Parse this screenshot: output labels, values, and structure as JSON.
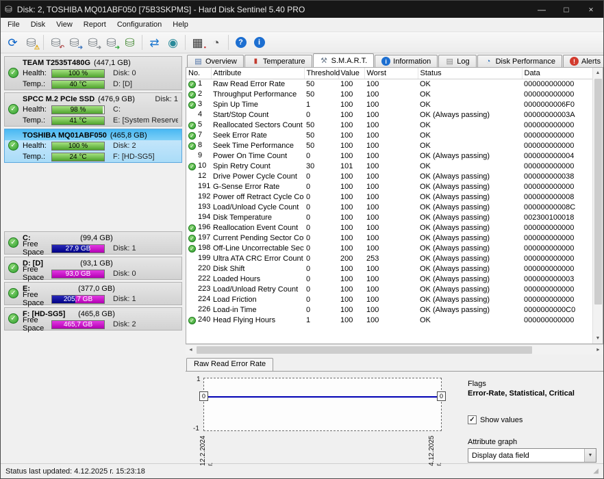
{
  "window": {
    "title": "Disk: 2, TOSHIBA MQ01ABF050 [75B3SKPMS]  -  Hard Disk Sentinel 5.40 PRO",
    "app_icon_glyph": "⛁",
    "minimize_glyph": "—",
    "maximize_glyph": "□",
    "close_glyph": "×"
  },
  "menu": {
    "items": [
      "File",
      "Disk",
      "View",
      "Report",
      "Configuration",
      "Help"
    ]
  },
  "toolbar": {
    "separators_after": [
      1,
      6,
      8,
      10
    ],
    "buttons": [
      {
        "name": "refresh-status",
        "glyph": "⟳",
        "color": "#0c64c8"
      },
      {
        "name": "disk-warning",
        "glyph": "⛁",
        "color": "#7a8187",
        "badge": "⚠",
        "badge_color": "#dd9f00"
      },
      {
        "name": "disk-remove",
        "glyph": "⛁",
        "color": "#7a8187",
        "badge": "↶",
        "badge_color": "#b05050"
      },
      {
        "name": "disk-test-read",
        "glyph": "⛁",
        "color": "#7a8187",
        "badge": "➜",
        "badge_color": "#4a7ec0"
      },
      {
        "name": "disk-test-write",
        "glyph": "⛁",
        "color": "#7a8187",
        "badge": "➜",
        "badge_color": "#8a8f94"
      },
      {
        "name": "disk-test-seek",
        "glyph": "⛁",
        "color": "#7a8187",
        "badge": "➜",
        "badge_color": "#3fae49"
      },
      {
        "name": "disk-backup",
        "glyph": "⛁",
        "color": "#4f8f3f"
      },
      {
        "name": "sync",
        "glyph": "⇄",
        "color": "#1e78d0"
      },
      {
        "name": "network-status",
        "glyph": "◉",
        "color": "#2a8a9a"
      },
      {
        "name": "levels",
        "glyph": "▦",
        "color": "#383838",
        "badge": "▪",
        "badge_color": "#c43232"
      },
      {
        "name": "gauge",
        "glyph": "◔",
        "color": "#565656"
      },
      {
        "name": "help",
        "glyph": "?",
        "color": "#ffffff",
        "circle": "#1d6fd1"
      },
      {
        "name": "info",
        "glyph": "i",
        "color": "#ffffff",
        "circle": "#1d6fd1"
      }
    ]
  },
  "sidebar": {
    "disks": [
      {
        "name": "TEAM T2535T480G",
        "size": "(447,1 GB)",
        "header_right": "",
        "health_label": "Health:",
        "health_value": "100 %",
        "health_pct": 100,
        "health_right": "Disk: 0",
        "temp_label": "Temp.:",
        "temp_value": "40 °C",
        "temp_pct": 100,
        "temp_right": "D: [D]",
        "selected": false
      },
      {
        "name": "SPCC M.2 PCIe SSD",
        "size": "(476,9 GB)",
        "header_right": "Disk: 1",
        "health_label": "Health:",
        "health_value": "98 %",
        "health_pct": 98,
        "health_right": "C:",
        "temp_label": "Temp.:",
        "temp_value": "41 °C",
        "temp_pct": 100,
        "temp_right": "E: [System Reserved]",
        "selected": false
      },
      {
        "name": "TOSHIBA MQ01ABF050",
        "size": "(465,8 GB)",
        "header_right": "",
        "health_label": "Health:",
        "health_value": "100 %",
        "health_pct": 100,
        "health_right": "Disk: 2",
        "temp_label": "Temp.:",
        "temp_value": "24 °C",
        "temp_pct": 100,
        "temp_right": "F: [HD-SG5]",
        "selected": true
      }
    ],
    "partitions": [
      {
        "letter": "C:",
        "size": "(99,4 GB)",
        "free_label": "Free Space",
        "free_value": "27,9 GB",
        "free_pct": 28,
        "right": "Disk: 1"
      },
      {
        "letter": "D: [D]",
        "size": "(93,1 GB)",
        "free_label": "Free Space",
        "free_value": "93,0 GB",
        "free_pct": 100,
        "right": "Disk: 0"
      },
      {
        "letter": "E:",
        "size": "(377,0 GB)",
        "free_label": "Free Space",
        "free_value": "205,7 GB",
        "free_pct": 55,
        "right": "Disk: 1"
      },
      {
        "letter": "F: [HD-SG5]",
        "size": "(465,8 GB)",
        "free_label": "Free Space",
        "free_value": "465,7 GB",
        "free_pct": 100,
        "right": "Disk: 2"
      }
    ]
  },
  "tabs": [
    {
      "label": "Overview",
      "icon": "overview",
      "active": false
    },
    {
      "label": "Temperature",
      "icon": "temperature",
      "active": false
    },
    {
      "label": "S.M.A.R.T.",
      "icon": "smart",
      "active": true
    },
    {
      "label": "Information",
      "icon": "information",
      "active": false
    },
    {
      "label": "Log",
      "icon": "log",
      "active": false
    },
    {
      "label": "Disk Performance",
      "icon": "performance",
      "active": false
    },
    {
      "label": "Alerts",
      "icon": "alerts",
      "active": false
    }
  ],
  "smart": {
    "columns": [
      "No.",
      "Attribute",
      "Threshold",
      "Value",
      "Worst",
      "Status",
      "Data"
    ],
    "rows": [
      {
        "ok": true,
        "no": "1",
        "attribute": "Raw Read Error Rate",
        "threshold": "50",
        "value": "100",
        "worst": "100",
        "status": "OK",
        "data": "000000000000"
      },
      {
        "ok": true,
        "no": "2",
        "attribute": "Throughput Performance",
        "threshold": "50",
        "value": "100",
        "worst": "100",
        "status": "OK",
        "data": "000000000000"
      },
      {
        "ok": true,
        "no": "3",
        "attribute": "Spin Up Time",
        "threshold": "1",
        "value": "100",
        "worst": "100",
        "status": "OK",
        "data": "0000000006F0"
      },
      {
        "ok": false,
        "no": "4",
        "attribute": "Start/Stop Count",
        "threshold": "0",
        "value": "100",
        "worst": "100",
        "status": "OK (Always passing)",
        "data": "00000000003A"
      },
      {
        "ok": true,
        "no": "5",
        "attribute": "Reallocated Sectors Count",
        "threshold": "50",
        "value": "100",
        "worst": "100",
        "status": "OK",
        "data": "000000000000"
      },
      {
        "ok": true,
        "no": "7",
        "attribute": "Seek Error Rate",
        "threshold": "50",
        "value": "100",
        "worst": "100",
        "status": "OK",
        "data": "000000000000"
      },
      {
        "ok": true,
        "no": "8",
        "attribute": "Seek Time Performance",
        "threshold": "50",
        "value": "100",
        "worst": "100",
        "status": "OK",
        "data": "000000000000"
      },
      {
        "ok": false,
        "no": "9",
        "attribute": "Power On Time Count",
        "threshold": "0",
        "value": "100",
        "worst": "100",
        "status": "OK (Always passing)",
        "data": "000000000004"
      },
      {
        "ok": true,
        "no": "10",
        "attribute": "Spin Retry Count",
        "threshold": "30",
        "value": "101",
        "worst": "100",
        "status": "OK",
        "data": "000000000000"
      },
      {
        "ok": false,
        "no": "12",
        "attribute": "Drive Power Cycle Count",
        "threshold": "0",
        "value": "100",
        "worst": "100",
        "status": "OK (Always passing)",
        "data": "000000000038"
      },
      {
        "ok": false,
        "no": "191",
        "attribute": "G-Sense Error Rate",
        "threshold": "0",
        "value": "100",
        "worst": "100",
        "status": "OK (Always passing)",
        "data": "000000000000"
      },
      {
        "ok": false,
        "no": "192",
        "attribute": "Power off Retract Cycle Count",
        "threshold": "0",
        "value": "100",
        "worst": "100",
        "status": "OK (Always passing)",
        "data": "000000000008"
      },
      {
        "ok": false,
        "no": "193",
        "attribute": "Load/Unload Cycle Count",
        "threshold": "0",
        "value": "100",
        "worst": "100",
        "status": "OK (Always passing)",
        "data": "00000000008C"
      },
      {
        "ok": false,
        "no": "194",
        "attribute": "Disk Temperature",
        "threshold": "0",
        "value": "100",
        "worst": "100",
        "status": "OK (Always passing)",
        "data": "002300100018"
      },
      {
        "ok": true,
        "no": "196",
        "attribute": "Reallocation Event Count",
        "threshold": "0",
        "value": "100",
        "worst": "100",
        "status": "OK (Always passing)",
        "data": "000000000000"
      },
      {
        "ok": true,
        "no": "197",
        "attribute": "Current Pending Sector Count",
        "threshold": "0",
        "value": "100",
        "worst": "100",
        "status": "OK (Always passing)",
        "data": "000000000000"
      },
      {
        "ok": true,
        "no": "198",
        "attribute": "Off-Line Uncorrectable Sector Co...",
        "threshold": "0",
        "value": "100",
        "worst": "100",
        "status": "OK (Always passing)",
        "data": "000000000000"
      },
      {
        "ok": false,
        "no": "199",
        "attribute": "Ultra ATA CRC Error Count",
        "threshold": "0",
        "value": "200",
        "worst": "253",
        "status": "OK (Always passing)",
        "data": "000000000000"
      },
      {
        "ok": false,
        "no": "220",
        "attribute": "Disk Shift",
        "threshold": "0",
        "value": "100",
        "worst": "100",
        "status": "OK (Always passing)",
        "data": "000000000000"
      },
      {
        "ok": false,
        "no": "222",
        "attribute": "Loaded Hours",
        "threshold": "0",
        "value": "100",
        "worst": "100",
        "status": "OK (Always passing)",
        "data": "000000000003"
      },
      {
        "ok": false,
        "no": "223",
        "attribute": "Load/Unload Retry Count",
        "threshold": "0",
        "value": "100",
        "worst": "100",
        "status": "OK (Always passing)",
        "data": "000000000000"
      },
      {
        "ok": false,
        "no": "224",
        "attribute": "Load Friction",
        "threshold": "0",
        "value": "100",
        "worst": "100",
        "status": "OK (Always passing)",
        "data": "000000000000"
      },
      {
        "ok": false,
        "no": "226",
        "attribute": "Load-in Time",
        "threshold": "0",
        "value": "100",
        "worst": "100",
        "status": "OK (Always passing)",
        "data": "0000000000C0"
      },
      {
        "ok": true,
        "no": "240",
        "attribute": "Head Flying Hours",
        "threshold": "1",
        "value": "100",
        "worst": "100",
        "status": "OK",
        "data": "000000000000"
      }
    ]
  },
  "attribute_panel": {
    "tab": "Raw Read Error Rate",
    "graph": {
      "y_ticks": [
        "1",
        "0",
        "-1"
      ],
      "x_labels": [
        "12.2.2024 г.",
        "4.12.2025 г."
      ],
      "value_left": "0",
      "value_right": "0",
      "line_color": "#0000b4"
    },
    "flags_label": "Flags",
    "flags_value": "Error-Rate, Statistical, Critical",
    "show_values_label": "Show values",
    "show_values_checked": true,
    "attribute_graph_label": "Attribute graph",
    "attribute_graph_value": "Display data field"
  },
  "status_bar": {
    "text": "Status last updated: 4.12.2025 г. 15:23:18"
  },
  "colors": {
    "used": "#000086",
    "free": "#b400b4",
    "health": "#4ea32c"
  }
}
